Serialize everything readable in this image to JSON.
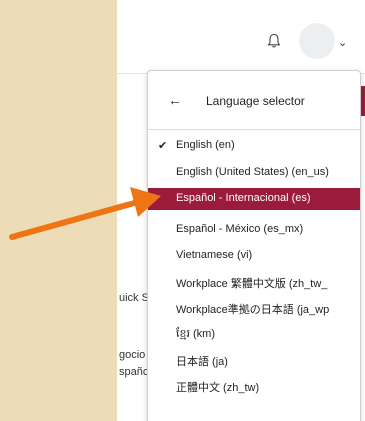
{
  "background_text": {
    "line1": "uick S",
    "line2": "gocio",
    "line3": "spañc"
  },
  "language_menu": {
    "title": "Language selector",
    "items": [
      {
        "label": "English (en)",
        "checked": true,
        "highlighted": false
      },
      {
        "label": "English (United States) (en_us)",
        "checked": false,
        "highlighted": false
      },
      {
        "label": "Español - Internacional (es)",
        "checked": false,
        "highlighted": true
      },
      {
        "label": "Español - México (es_mx)",
        "checked": false,
        "highlighted": false
      },
      {
        "label": "Vietnamese (vi)",
        "checked": false,
        "highlighted": false
      },
      {
        "label": "Workplace 繁體中文版 (zh_tw_",
        "checked": false,
        "highlighted": false
      },
      {
        "label": "Workplace準拠の日本語 (ja_wp",
        "checked": false,
        "highlighted": false
      },
      {
        "label": "ខ្មែរ (km)",
        "checked": false,
        "highlighted": false
      },
      {
        "label": "日本語 (ja)",
        "checked": false,
        "highlighted": false
      },
      {
        "label": "正體中文 (zh_tw)",
        "checked": false,
        "highlighted": false
      }
    ]
  },
  "colors": {
    "page_background": "#ecdcb8",
    "highlight": "#9b1c3a",
    "annotation_arrow": "#ee7414"
  },
  "icons": {
    "notification": "bell-icon",
    "user_menu": "avatar",
    "user_menu_caret": "chevron-down-icon",
    "back": "arrow-left-icon",
    "checked": "check-icon",
    "annotation": "arrow-annotation"
  }
}
